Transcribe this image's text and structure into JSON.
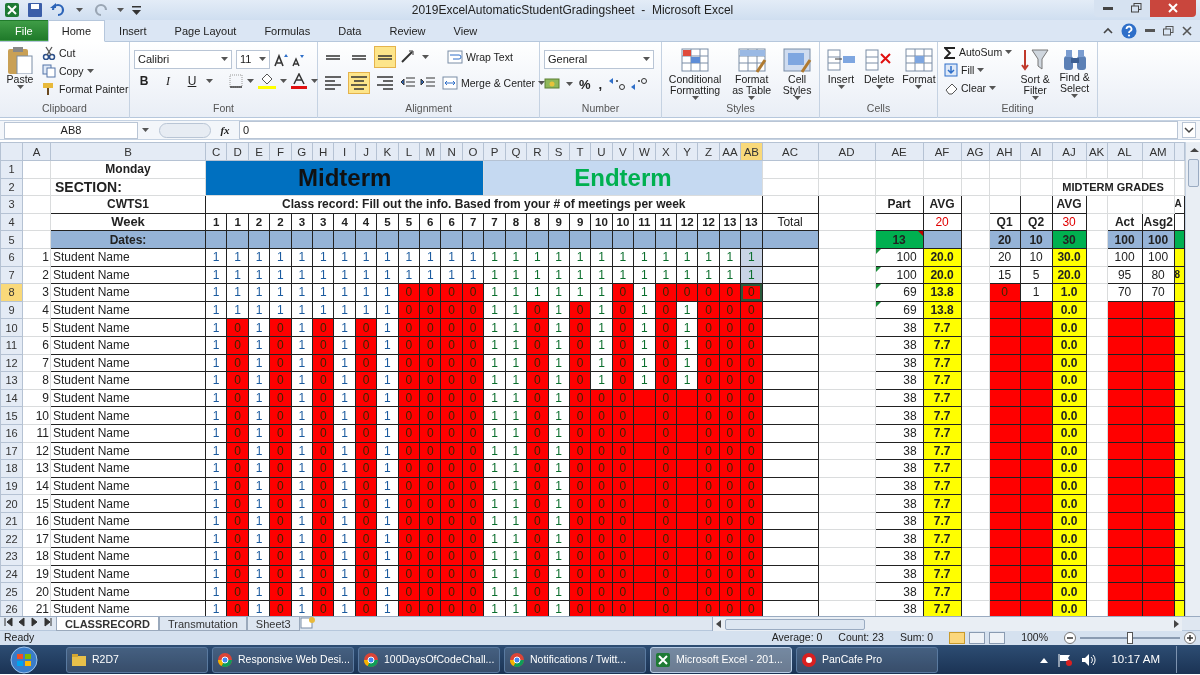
{
  "window": {
    "title": "2019ExcelAutomaticStudentGradingsheet  -  Microsoft Excel"
  },
  "ribbon_tabs": [
    {
      "label": "File",
      "kind": "file",
      "selected": false
    },
    {
      "label": "Home",
      "kind": "tab",
      "selected": true
    },
    {
      "label": "Insert",
      "kind": "tab",
      "selected": false
    },
    {
      "label": "Page Layout",
      "kind": "tab",
      "selected": false
    },
    {
      "label": "Formulas",
      "kind": "tab",
      "selected": false
    },
    {
      "label": "Data",
      "kind": "tab",
      "selected": false
    },
    {
      "label": "Review",
      "kind": "tab",
      "selected": false
    },
    {
      "label": "View",
      "kind": "tab",
      "selected": false
    }
  ],
  "ribbon_groups": [
    {
      "label": "Clipboard",
      "buttons": [
        {
          "label": "Paste",
          "dropdown": true
        },
        {
          "label": "Cut",
          "dropdown": false
        },
        {
          "label": "Copy",
          "dropdown": true
        },
        {
          "label": "Format Painter",
          "dropdown": false
        }
      ]
    },
    {
      "label": "Font",
      "fields": [
        "Calibri",
        "11"
      ],
      "glyphs": [
        "B",
        "I",
        "U"
      ]
    },
    {
      "label": "Alignment",
      "toggles": [
        {
          "selected": false
        },
        {
          "selected": false
        },
        {
          "selected": true
        },
        {
          "selected": false
        },
        {
          "selected": true
        },
        {
          "selected": false
        }
      ],
      "buttons": [
        {
          "label": "Wrap Text",
          "dropdown": false
        },
        {
          "label": "Merge & Center",
          "dropdown": true
        }
      ]
    },
    {
      "label": "Number",
      "fields": [
        "General"
      ],
      "glyphs": [
        "%",
        ","
      ]
    },
    {
      "label": "Styles",
      "buttons": [
        {
          "label": "Conditional Formatting",
          "dropdown": true
        },
        {
          "label": "Format as Table",
          "dropdown": true
        },
        {
          "label": "Cell Styles",
          "dropdown": true
        }
      ]
    },
    {
      "label": "Cells",
      "buttons": [
        {
          "label": "Insert",
          "dropdown": true
        },
        {
          "label": "Delete",
          "dropdown": true
        },
        {
          "label": "Format",
          "dropdown": true
        }
      ]
    },
    {
      "label": "Editing",
      "buttons": [
        {
          "label": "AutoSum",
          "dropdown": true
        },
        {
          "label": "Fill",
          "dropdown": true
        },
        {
          "label": "Clear",
          "dropdown": true
        },
        {
          "label": "Sort & Filter",
          "dropdown": true
        },
        {
          "label": "Find & Select",
          "dropdown": true
        }
      ]
    }
  ],
  "formula_bar": {
    "name_box": "AB8",
    "function_label": "fx",
    "value": "0"
  },
  "sheet": {
    "columns": [
      {
        "label": "A",
        "selected": false
      },
      {
        "label": "B",
        "selected": false
      },
      {
        "label": "C",
        "selected": false
      },
      {
        "label": "D",
        "selected": false
      },
      {
        "label": "E",
        "selected": false
      },
      {
        "label": "F",
        "selected": false
      },
      {
        "label": "G",
        "selected": false
      },
      {
        "label": "H",
        "selected": false
      },
      {
        "label": "I",
        "selected": false
      },
      {
        "label": "J",
        "selected": false
      },
      {
        "label": "K",
        "selected": false
      },
      {
        "label": "L",
        "selected": false
      },
      {
        "label": "M",
        "selected": false
      },
      {
        "label": "N",
        "selected": false
      },
      {
        "label": "O",
        "selected": false
      },
      {
        "label": "P",
        "selected": false
      },
      {
        "label": "Q",
        "selected": false
      },
      {
        "label": "R",
        "selected": false
      },
      {
        "label": "S",
        "selected": false
      },
      {
        "label": "T",
        "selected": false
      },
      {
        "label": "U",
        "selected": false
      },
      {
        "label": "V",
        "selected": false
      },
      {
        "label": "W",
        "selected": false
      },
      {
        "label": "X",
        "selected": false
      },
      {
        "label": "Y",
        "selected": false
      },
      {
        "label": "Z",
        "selected": false
      },
      {
        "label": "AA",
        "selected": false
      },
      {
        "label": "AB",
        "selected": true
      },
      {
        "label": "AC",
        "selected": false
      },
      {
        "label": "AD",
        "selected": false
      },
      {
        "label": "AE",
        "selected": false
      },
      {
        "label": "AF",
        "selected": false
      },
      {
        "label": "AG",
        "selected": false
      },
      {
        "label": "AH",
        "selected": false
      },
      {
        "label": "AI",
        "selected": false
      },
      {
        "label": "AJ",
        "selected": false
      },
      {
        "label": "AK",
        "selected": false
      },
      {
        "label": "AL",
        "selected": false
      },
      {
        "label": "AM",
        "selected": false
      }
    ],
    "rows": [
      {
        "label": "1",
        "selected": false
      },
      {
        "label": "2",
        "selected": false
      },
      {
        "label": "3",
        "selected": false
      },
      {
        "label": "4",
        "selected": false
      },
      {
        "label": "5",
        "selected": false
      },
      {
        "label": "6",
        "selected": false
      },
      {
        "label": "7",
        "selected": false
      },
      {
        "label": "8",
        "selected": true
      },
      {
        "label": "9",
        "selected": false
      },
      {
        "label": "10",
        "selected": false
      },
      {
        "label": "11",
        "selected": false
      },
      {
        "label": "12",
        "selected": false
      },
      {
        "label": "13",
        "selected": false
      },
      {
        "label": "14",
        "selected": false
      },
      {
        "label": "15",
        "selected": false
      },
      {
        "label": "16",
        "selected": false
      },
      {
        "label": "17",
        "selected": false
      },
      {
        "label": "18",
        "selected": false
      },
      {
        "label": "19",
        "selected": false
      },
      {
        "label": "20",
        "selected": false
      },
      {
        "label": "21",
        "selected": false
      },
      {
        "label": "22",
        "selected": false
      },
      {
        "label": "23",
        "selected": false
      },
      {
        "label": "24",
        "selected": false
      },
      {
        "label": "25",
        "selected": false
      },
      {
        "label": "26",
        "selected": false
      }
    ],
    "day": "Monday",
    "section_label": "SECTION:",
    "course": "CWTS1",
    "week_label": "Week",
    "dates_label": "Dates:",
    "instructions": "Class record: Fill out the info. Based from your # of meetings per week",
    "terms": [
      {
        "label": "Midterm",
        "kind": "midterm",
        "weeks": [
          "1",
          "1",
          "2",
          "2",
          "3",
          "3",
          "4",
          "4",
          "5",
          "5",
          "6",
          "6",
          "7"
        ]
      },
      {
        "label": "Endterm",
        "kind": "endterm",
        "weeks": [
          "7",
          "8",
          "8",
          "9",
          "9",
          "10",
          "10",
          "11",
          "11",
          "12",
          "12",
          "13",
          "13"
        ]
      }
    ],
    "total_label": "Total",
    "grades_title": "MIDTERM GRADES",
    "part": {
      "label": "Part",
      "max": "13",
      "comment": true
    },
    "part_avg": {
      "label": "AVG",
      "weight": "20"
    },
    "quizzes": [
      {
        "label": "Q1",
        "max": "20"
      },
      {
        "label": "Q2",
        "max": "10"
      }
    ],
    "quiz_avg": {
      "label": "AVG",
      "weight": "30",
      "max": "30"
    },
    "activities": [
      {
        "label": "Act",
        "max": "100"
      },
      {
        "label": "Asg2",
        "max": "100"
      }
    ],
    "next_column": {
      "label": "A"
    },
    "students": [
      {
        "no": "1",
        "name": "Student Name",
        "attendance": [
          "1",
          "1",
          "1",
          "1",
          "1",
          "1",
          "1",
          "1",
          "1",
          "1",
          "1",
          "1",
          "1",
          "1",
          "1",
          "1",
          "1",
          "1",
          "1",
          "1",
          "1",
          "1",
          "1",
          "1",
          "1",
          "1"
        ],
        "part": "100",
        "flagged": true,
        "part_avg": "20.0",
        "quizzes": [
          "20",
          "10"
        ],
        "quiz_avg": "30.0",
        "activities": [
          "100",
          "100"
        ]
      },
      {
        "no": "2",
        "name": "Student Name",
        "attendance": [
          "1",
          "1",
          "1",
          "1",
          "1",
          "1",
          "1",
          "1",
          "1",
          "1",
          "1",
          "1",
          "1",
          "1",
          "1",
          "1",
          "1",
          "1",
          "1",
          "1",
          "1",
          "1",
          "1",
          "1",
          "1",
          "1"
        ],
        "part": "100",
        "flagged": true,
        "part_avg": "20.0",
        "quizzes": [
          "15",
          "5"
        ],
        "quiz_avg": "20.0",
        "activities": [
          "95",
          "80"
        ],
        "next": "8"
      },
      {
        "no": "3",
        "name": "Student Name",
        "attendance": [
          "1",
          "1",
          "1",
          "1",
          "1",
          "1",
          "1",
          "1",
          "1",
          "0",
          "0",
          "0",
          "0",
          "1",
          "1",
          "1",
          "1",
          "1",
          "1",
          "0",
          "1",
          "0",
          "0",
          "0",
          "0",
          "0"
        ],
        "part": "69",
        "flagged": true,
        "part_avg": "13.8",
        "quizzes": [
          "0",
          "1"
        ],
        "quiz_avg": "1.0",
        "activities": [
          "70",
          "70"
        ]
      },
      {
        "no": "4",
        "name": "Student Name",
        "attendance": [
          "1",
          "1",
          "1",
          "1",
          "1",
          "1",
          "1",
          "1",
          "1",
          "0",
          "0",
          "0",
          "0",
          "1",
          "1",
          "0",
          "1",
          "0",
          "1",
          "0",
          "1",
          "0",
          "1",
          "0",
          "0",
          "0"
        ],
        "part": "69",
        "flagged": true,
        "part_avg": "13.8",
        "quiz_avg": "0.0"
      },
      {
        "no": "5",
        "name": "Student Name",
        "attendance": [
          "1",
          "0",
          "1",
          "0",
          "1",
          "0",
          "1",
          "0",
          "1",
          "0",
          "0",
          "0",
          "0",
          "1",
          "1",
          "0",
          "1",
          "0",
          "1",
          "0",
          "1",
          "0",
          "1",
          "0",
          "0",
          "0"
        ],
        "part": "38",
        "flagged": false,
        "part_avg": "7.7",
        "quiz_avg": "0.0"
      },
      {
        "no": "6",
        "name": "Student Name",
        "attendance": [
          "1",
          "0",
          "1",
          "0",
          "1",
          "0",
          "1",
          "0",
          "1",
          "0",
          "0",
          "0",
          "0",
          "1",
          "1",
          "0",
          "1",
          "0",
          "1",
          "0",
          "1",
          "0",
          "1",
          "0",
          "0",
          "0"
        ],
        "part": "38",
        "flagged": false,
        "part_avg": "7.7",
        "quiz_avg": "0.0"
      },
      {
        "no": "7",
        "name": "Student Name",
        "attendance": [
          "1",
          "0",
          "1",
          "0",
          "1",
          "0",
          "1",
          "0",
          "1",
          "0",
          "0",
          "0",
          "0",
          "1",
          "1",
          "0",
          "1",
          "0",
          "1",
          "0",
          "1",
          "0",
          "1",
          "0",
          "0",
          "0"
        ],
        "part": "38",
        "flagged": false,
        "part_avg": "7.7",
        "quiz_avg": "0.0"
      },
      {
        "no": "8",
        "name": "Student Name",
        "attendance": [
          "1",
          "0",
          "1",
          "0",
          "1",
          "0",
          "1",
          "0",
          "1",
          "0",
          "0",
          "0",
          "0",
          "1",
          "1",
          "0",
          "1",
          "0",
          "1",
          "0",
          "1",
          "0",
          "1",
          "0",
          "0",
          "0"
        ],
        "part": "38",
        "flagged": false,
        "part_avg": "7.7",
        "quiz_avg": "0.0"
      },
      {
        "no": "9",
        "name": "Student Name",
        "attendance": [
          "1",
          "0",
          "1",
          "0",
          "1",
          "0",
          "1",
          "0",
          "1",
          "0",
          "0",
          "0",
          "0",
          "1",
          "1",
          "0",
          "1",
          "0",
          "0",
          "0",
          {
            "kind": "blank"
          },
          "0",
          {
            "kind": "blank"
          },
          "0",
          "0",
          "0"
        ],
        "part": "38",
        "flagged": false,
        "part_avg": "7.7",
        "quiz_avg": "0.0"
      },
      {
        "no": "10",
        "name": "Student Name",
        "attendance": [
          "1",
          "0",
          "1",
          "0",
          "1",
          "0",
          "1",
          "0",
          "1",
          "0",
          "0",
          "0",
          "0",
          "1",
          "1",
          "0",
          "1",
          "0",
          "0",
          "0",
          {
            "kind": "blank"
          },
          "0",
          {
            "kind": "blank"
          },
          "0",
          "0",
          "0"
        ],
        "part": "38",
        "flagged": false,
        "part_avg": "7.7",
        "quiz_avg": "0.0"
      },
      {
        "no": "11",
        "name": "Student Name",
        "attendance": [
          "1",
          "0",
          "1",
          "0",
          "1",
          "0",
          "1",
          "0",
          "1",
          "0",
          "0",
          "0",
          "0",
          "1",
          "1",
          "0",
          "1",
          "0",
          "0",
          "0",
          {
            "kind": "blank"
          },
          "0",
          {
            "kind": "blank"
          },
          "0",
          "0",
          "0"
        ],
        "part": "38",
        "flagged": false,
        "part_avg": "7.7",
        "quiz_avg": "0.0"
      },
      {
        "no": "12",
        "name": "Student Name",
        "attendance": [
          "1",
          "0",
          "1",
          "0",
          "1",
          "0",
          "1",
          "0",
          "1",
          "0",
          "0",
          "0",
          "0",
          "1",
          "1",
          "0",
          "1",
          "0",
          "0",
          "0",
          {
            "kind": "blank"
          },
          "0",
          {
            "kind": "blank"
          },
          "0",
          "0",
          "0"
        ],
        "part": "38",
        "flagged": false,
        "part_avg": "7.7",
        "quiz_avg": "0.0"
      },
      {
        "no": "13",
        "name": "Student Name",
        "attendance": [
          "1",
          "0",
          "1",
          "0",
          "1",
          "0",
          "1",
          "0",
          "1",
          "0",
          "0",
          "0",
          "0",
          "1",
          "1",
          "0",
          "1",
          "0",
          "0",
          "0",
          {
            "kind": "blank"
          },
          "0",
          {
            "kind": "blank"
          },
          "0",
          "0",
          "0"
        ],
        "part": "38",
        "flagged": false,
        "part_avg": "7.7",
        "quiz_avg": "0.0"
      },
      {
        "no": "14",
        "name": "Student Name",
        "attendance": [
          "1",
          "0",
          "1",
          "0",
          "1",
          "0",
          "1",
          "0",
          "1",
          "0",
          "0",
          "0",
          "0",
          "1",
          "1",
          "0",
          "1",
          "0",
          "0",
          "0",
          {
            "kind": "blank"
          },
          "0",
          {
            "kind": "blank"
          },
          "0",
          "0",
          "0"
        ],
        "part": "38",
        "flagged": false,
        "part_avg": "7.7",
        "quiz_avg": "0.0"
      },
      {
        "no": "15",
        "name": "Student Name",
        "attendance": [
          "1",
          "0",
          "1",
          "0",
          "1",
          "0",
          "1",
          "0",
          "1",
          "0",
          "0",
          "0",
          "0",
          "1",
          "1",
          "0",
          "1",
          "0",
          "0",
          "0",
          {
            "kind": "blank"
          },
          "0",
          {
            "kind": "blank"
          },
          "0",
          "0",
          "0"
        ],
        "part": "38",
        "flagged": false,
        "part_avg": "7.7",
        "quiz_avg": "0.0"
      },
      {
        "no": "16",
        "name": "Student Name",
        "attendance": [
          "1",
          "0",
          "1",
          "0",
          "1",
          "0",
          "1",
          "0",
          "1",
          "0",
          "0",
          "0",
          "0",
          "1",
          "1",
          "0",
          "1",
          "0",
          "0",
          "0",
          {
            "kind": "blank"
          },
          "0",
          {
            "kind": "blank"
          },
          "0",
          "0",
          "0"
        ],
        "part": "38",
        "flagged": false,
        "part_avg": "7.7",
        "quiz_avg": "0.0"
      },
      {
        "no": "17",
        "name": "Student Name",
        "attendance": [
          "1",
          "0",
          "1",
          "0",
          "1",
          "0",
          "1",
          "0",
          "1",
          "0",
          "0",
          "0",
          "0",
          "1",
          "1",
          "0",
          "1",
          "0",
          "0",
          "0",
          {
            "kind": "blank"
          },
          "0",
          {
            "kind": "blank"
          },
          "0",
          "0",
          "0"
        ],
        "part": "38",
        "flagged": false,
        "part_avg": "7.7",
        "quiz_avg": "0.0"
      },
      {
        "no": "18",
        "name": "Student Name",
        "attendance": [
          "1",
          "0",
          "1",
          "0",
          "1",
          "0",
          "1",
          "0",
          "1",
          "0",
          "0",
          "0",
          "0",
          "1",
          "1",
          "0",
          "1",
          "0",
          "0",
          "0",
          {
            "kind": "blank"
          },
          "0",
          {
            "kind": "blank"
          },
          "0",
          "0",
          "0"
        ],
        "part": "38",
        "flagged": false,
        "part_avg": "7.7",
        "quiz_avg": "0.0"
      },
      {
        "no": "19",
        "name": "Student Name",
        "attendance": [
          "1",
          "0",
          "1",
          "0",
          "1",
          "0",
          "1",
          "0",
          "1",
          "0",
          "0",
          "0",
          "0",
          "1",
          "1",
          "0",
          "1",
          "0",
          "0",
          "0",
          {
            "kind": "blank"
          },
          "0",
          {
            "kind": "blank"
          },
          "0",
          "0",
          "0"
        ],
        "part": "38",
        "flagged": false,
        "part_avg": "7.7",
        "quiz_avg": "0.0"
      },
      {
        "no": "20",
        "name": "Student Name",
        "attendance": [
          "1",
          "0",
          "1",
          "0",
          "1",
          "0",
          "1",
          "0",
          "1",
          "0",
          "0",
          "0",
          "0",
          "1",
          "1",
          "0",
          "1",
          "0",
          "0",
          "0",
          {
            "kind": "blank"
          },
          "0",
          {
            "kind": "blank"
          },
          "0",
          "0",
          "0"
        ],
        "part": "38",
        "flagged": false,
        "part_avg": "7.7",
        "quiz_avg": "0.0"
      },
      {
        "no": "21",
        "name": "Student Name",
        "attendance": [
          "1",
          "0",
          "1",
          "0",
          "1",
          "0",
          "1",
          "0",
          "1",
          "0",
          "0",
          "0",
          "0",
          "1",
          "1",
          "0",
          "1",
          "0",
          "0",
          "0",
          {
            "kind": "blank"
          },
          "0",
          {
            "kind": "blank"
          },
          "0",
          "0",
          "0"
        ],
        "part": "38",
        "flagged": false,
        "part_avg": "7.7",
        "quiz_avg": "0.0"
      }
    ]
  },
  "sheet_tabs": [
    {
      "label": "CLASSRECORD",
      "selected": true
    },
    {
      "label": "Transmutation",
      "selected": false
    },
    {
      "label": "Sheet3",
      "selected": false
    }
  ],
  "status_bar": {
    "mode": "Ready",
    "stats": [
      "Average: 0",
      "Count: 23",
      "Sum: 0"
    ],
    "views": [
      {
        "selected": true
      },
      {
        "selected": false
      },
      {
        "selected": false
      }
    ],
    "zoom": "100%",
    "zoom_slider": {
      "level": 0.5
    }
  },
  "taskbar": {
    "items": [
      {
        "label": "R2D7",
        "kind": "folder",
        "selected": false
      },
      {
        "label": "Responsive Web Desi...",
        "kind": "browser",
        "selected": false
      },
      {
        "label": "100DaysOfCodeChall...",
        "kind": "browser",
        "selected": false
      },
      {
        "label": "Notifications / Twitt...",
        "kind": "browser",
        "selected": false
      },
      {
        "label": "Microsoft Excel - 201...",
        "kind": "excel",
        "selected": true
      },
      {
        "label": "PanCafe Pro",
        "kind": "app",
        "selected": false
      }
    ],
    "clock": "10:17 AM"
  }
}
